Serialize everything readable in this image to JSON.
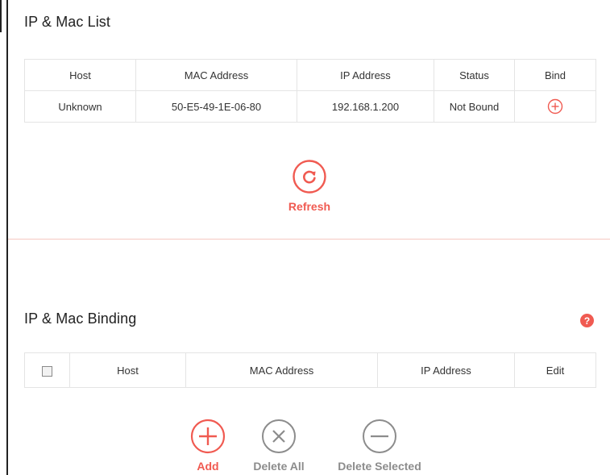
{
  "ip_mac_list": {
    "title": "IP & Mac List",
    "columns": [
      "Host",
      "MAC Address",
      "IP Address",
      "Status",
      "Bind"
    ],
    "rows": [
      {
        "host": "Unknown",
        "mac": "50-E5-49-1E-06-80",
        "ip": "192.168.1.200",
        "status": "Not Bound",
        "bind_icon": "plus-circle-icon"
      }
    ],
    "refresh_label": "Refresh"
  },
  "ip_mac_binding": {
    "title": "IP & Mac Binding",
    "help_icon": "question-icon",
    "columns": [
      "Host",
      "MAC Address",
      "IP Address",
      "Edit"
    ],
    "rows": [],
    "actions": {
      "add_label": "Add",
      "delete_all_label": "Delete All",
      "delete_selected_label": "Delete Selected"
    }
  },
  "colors": {
    "accent": "#f05a51",
    "disabled": "#8c8c8c",
    "divider": "#f7c9c1",
    "border": "#e4e4e4"
  }
}
